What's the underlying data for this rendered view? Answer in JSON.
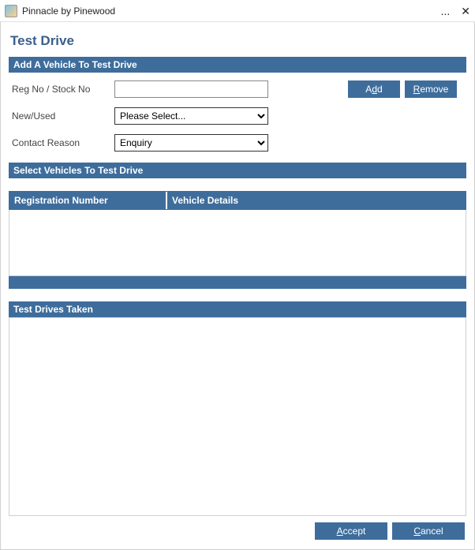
{
  "window": {
    "title": "Pinnacle by Pinewood",
    "more": "...",
    "close": "✕"
  },
  "page": {
    "title": "Test Drive"
  },
  "addVehicle": {
    "heading": "Add A Vehicle To Test Drive",
    "regLabel": "Reg No / Stock No",
    "regValue": "",
    "newUsedLabel": "New/Used",
    "newUsedValue": "Please Select...",
    "contactReasonLabel": "Contact Reason",
    "contactReasonValue": "Enquiry",
    "addBtn": {
      "pre": "A",
      "u": "d",
      "post": "d"
    },
    "removeBtn": {
      "pre": "",
      "u": "R",
      "post": "emove"
    }
  },
  "selectVehicles": {
    "heading": "Select Vehicles To Test Drive",
    "colReg": "Registration Number",
    "colDetails": "Vehicle Details"
  },
  "taken": {
    "heading": "Test Drives Taken"
  },
  "footer": {
    "accept": {
      "pre": "",
      "u": "A",
      "post": "ccept"
    },
    "cancel": {
      "pre": "",
      "u": "C",
      "post": "ancel"
    }
  }
}
